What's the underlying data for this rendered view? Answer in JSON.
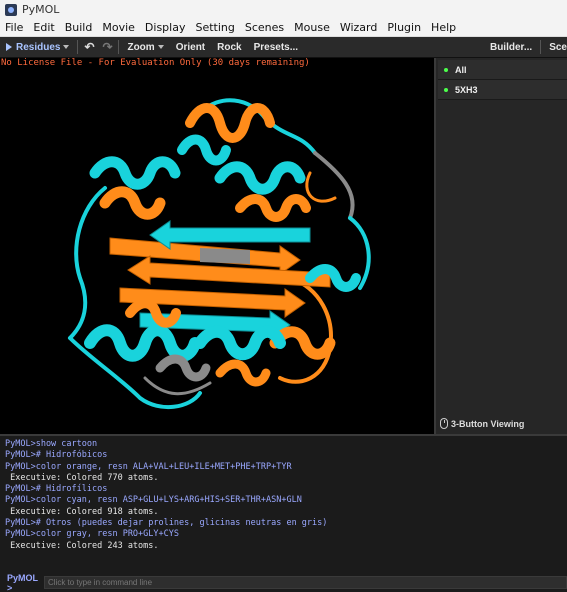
{
  "window": {
    "title": "PyMOL",
    "icon": "pymol-logo-icon"
  },
  "menu": [
    "File",
    "Edit",
    "Build",
    "Movie",
    "Display",
    "Setting",
    "Scenes",
    "Mouse",
    "Wizard",
    "Plugin",
    "Help"
  ],
  "toolbar": {
    "selection_mode": "Residues",
    "undo_icon": "undo-icon",
    "redo_icon": "redo-icon",
    "zoom": "Zoom",
    "orient": "Orient",
    "rock": "Rock",
    "presets": "Presets...",
    "builder": "Builder...",
    "overflow": "Sce"
  },
  "viewport": {
    "license_notice": "No License File - For Evaluation Only (30 days remaining)",
    "colors": {
      "hydrophobic": "#ff8c1a",
      "hydrophilic": "#19d3dc",
      "neutral": "#8a8a8a"
    }
  },
  "objects": [
    {
      "name": "All",
      "enabled": true
    },
    {
      "name": "5XH3",
      "enabled": true
    }
  ],
  "mouse_mode": "3-Button Viewing",
  "console": {
    "lines": [
      {
        "type": "cmd",
        "text": "PyMOL>show cartoon"
      },
      {
        "type": "cmd",
        "text": "PyMOL># Hidrofóbicos"
      },
      {
        "type": "cmd",
        "text": "PyMOL>color orange, resn ALA+VAL+LEU+ILE+MET+PHE+TRP+TYR"
      },
      {
        "type": "out",
        "text": " Executive: Colored 770 atoms."
      },
      {
        "type": "cmd",
        "text": "PyMOL># Hidrofílicos"
      },
      {
        "type": "cmd",
        "text": "PyMOL>color cyan, resn ASP+GLU+LYS+ARG+HIS+SER+THR+ASN+GLN"
      },
      {
        "type": "out",
        "text": " Executive: Colored 918 atoms."
      },
      {
        "type": "cmd",
        "text": "PyMOL># Otros (puedes dejar prolines, glicinas neutras en gris)"
      },
      {
        "type": "cmd",
        "text": "PyMOL>color gray, resn PRO+GLY+CYS"
      },
      {
        "type": "out",
        "text": " Executive: Colored 243 atoms."
      }
    ],
    "prompt": "PyMOL >",
    "input_placeholder": "Click to type in command line"
  }
}
